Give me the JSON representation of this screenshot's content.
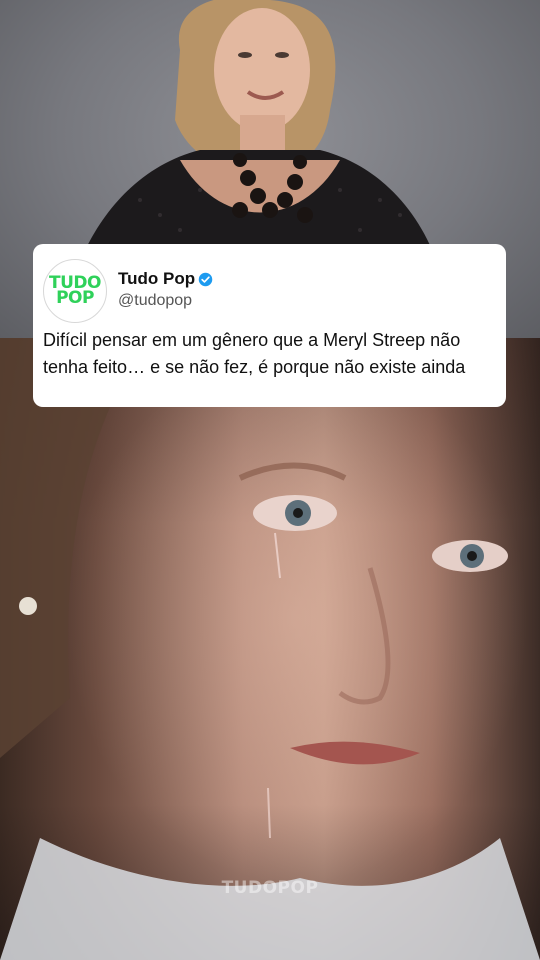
{
  "tweet": {
    "logo_line1": "TUDO",
    "logo_line2": "POP",
    "display_name": "Tudo Pop",
    "handle": "@tudopop",
    "text": "Difícil pensar em um gênero que a Meryl Streep não tenha feito… e se não fez, é porque não existe ainda"
  },
  "watermark": "TUDOPOP",
  "colors": {
    "brand_green": "#2fd15a",
    "verified_blue": "#1d9bf0"
  }
}
